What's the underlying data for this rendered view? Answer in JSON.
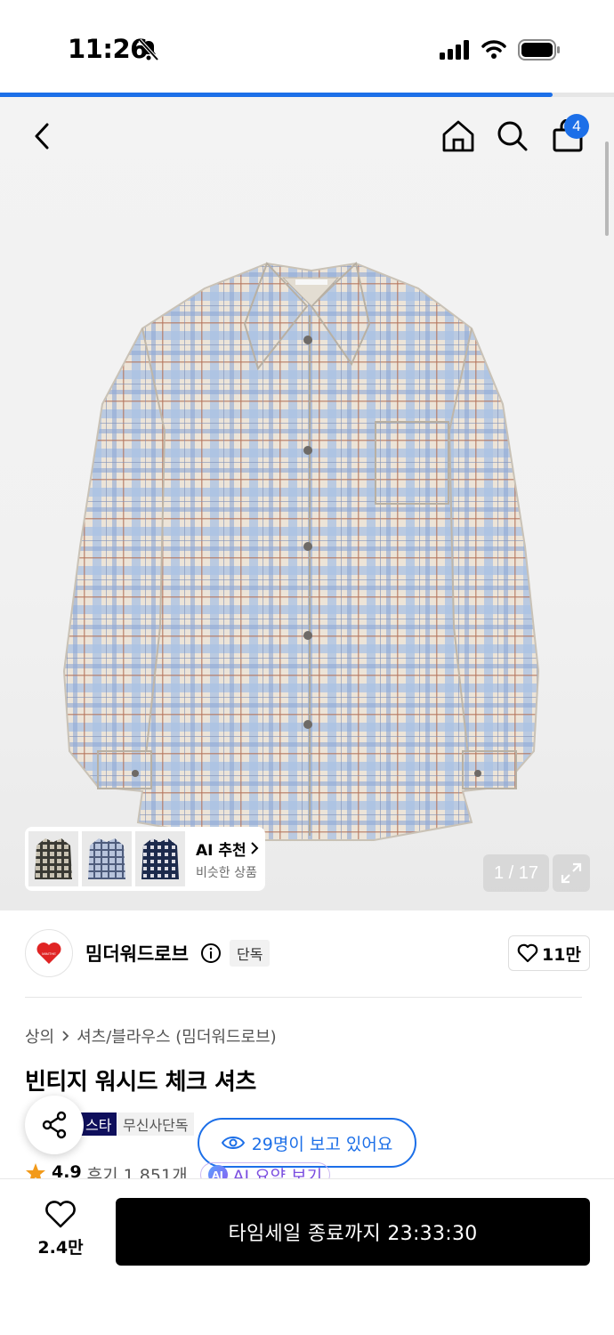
{
  "status_bar": {
    "time": "11:26",
    "icons": [
      "bell-slash-icon",
      "cellular-signal-icon",
      "wifi-icon",
      "battery-icon"
    ]
  },
  "progress": {
    "fraction": 0.9
  },
  "nav": {
    "back_icon": "chevron-left-icon",
    "home_icon": "home-icon",
    "search_icon": "search-icon",
    "cart_icon": "shopping-bag-icon",
    "cart_count": "4"
  },
  "gallery": {
    "ai_recommend_title": "AI 추천",
    "ai_recommend_subtitle": "비슷한 상품",
    "page_counter": "1 / 17",
    "expand_icon": "expand-icon"
  },
  "brand": {
    "name": "밈더워드로브",
    "logo_text": "MIMTHE",
    "exclusive_label": "단독",
    "like_count": "11만"
  },
  "product": {
    "breadcrumb_category": "상의",
    "breadcrumb_subcategory": "셔츠/블라우스 (밈더워드로브)",
    "title": "빈티지 워시드 체크 셔츠",
    "tag_star": "스타",
    "tag_musinsa": "무신사단독",
    "viewers_text": "29명이 보고 있어요",
    "rating": "4.9",
    "review_text": "후기 1,851개",
    "ai_summary": "AI 요약 보기",
    "ai_badge": "AI"
  },
  "bottom": {
    "wish_count": "2.4만",
    "buy_label": "타임세일 종료까지 23:33:30"
  },
  "colors": {
    "accent": "#1c6fe8",
    "buy_button": "#000000",
    "shirt_blue": "#9db5dc",
    "shirt_cream": "#ece4d8",
    "shirt_red": "#b5735a"
  }
}
